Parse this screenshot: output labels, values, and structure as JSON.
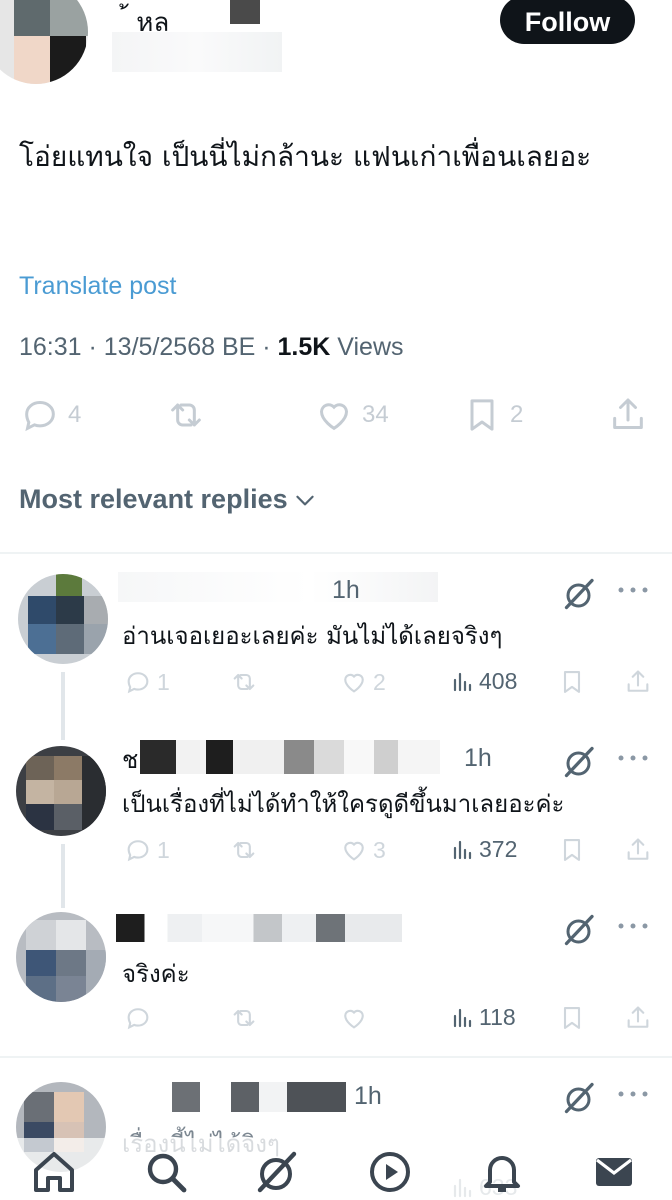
{
  "header": {
    "name_fragment": "้  หล",
    "follow_label": "Follow"
  },
  "post": {
    "text": "โอ่ยแทนใจ เป็นนี่ไม่กล้านะ แฟนเก่าเพื่อนเลยอะ",
    "translate_label": "Translate post",
    "time": "16:31",
    "date": "13/5/2568 BE",
    "views_count": "1.5K",
    "views_label": "Views",
    "stats": {
      "replies": "4",
      "likes": "34",
      "bookmarks": "2"
    }
  },
  "sort": {
    "label": "Most relevant replies"
  },
  "replies": [
    {
      "time": "1h",
      "text": "อ่านเจอเยอะเลยค่ะ มันไม่ได้เลยจริงๆ",
      "reply_count": "1",
      "like_count": "2",
      "views": "408"
    },
    {
      "name_initial": "ช",
      "time": "1h",
      "text": "เป็นเรื่องที่ไม่ได้ทำให้ใครดูดีขึ้นมาเลยอะค่ะ",
      "reply_count": "1",
      "like_count": "3",
      "views": "372"
    },
    {
      "text": "จริงค่ะ",
      "views": "118"
    },
    {
      "time": "1h",
      "text": "เรื่องนี้ไม่ได้จิงๆ",
      "views": "633"
    }
  ],
  "icons": {
    "reply": "reply-icon",
    "repost": "repost-icon",
    "like": "heart-icon",
    "bookmark": "bookmark-icon",
    "share": "share-icon",
    "views": "views-icon",
    "grok": "grok-icon",
    "more": "more-icon",
    "nav": [
      "home-icon",
      "search-icon",
      "grok-icon",
      "video-icon",
      "notifications-icon",
      "messages-icon"
    ]
  },
  "colors": {
    "link": "#4a9bd3",
    "text": "#0f1419",
    "secondary": "#536471",
    "faint": "#cfd6dc"
  }
}
